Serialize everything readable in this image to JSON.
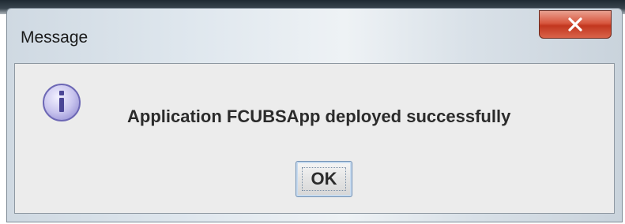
{
  "dialog": {
    "title": "Message",
    "message": "Application FCUBSApp deployed successfully",
    "ok_label": "OK",
    "icon": "info-icon",
    "close_icon": "close-icon"
  },
  "colors": {
    "close_button": "#c94a30",
    "icon_fill": "#c9c5ee",
    "icon_border": "#6d68b5",
    "client_bg": "#ececec"
  }
}
